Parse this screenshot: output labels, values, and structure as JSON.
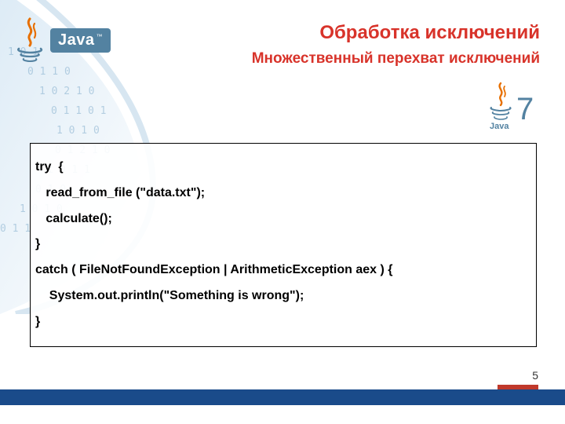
{
  "branding": {
    "wordmark": "Java",
    "trademark": "™",
    "version_badge": "7"
  },
  "headings": {
    "title": "Обработка исключений",
    "subtitle": "Множественный перехват исключений"
  },
  "code": {
    "line1": "try  {",
    "line2": "   read_from_file (\"data.txt\");",
    "line3": "   calculate();",
    "line4": "}",
    "line5": "catch ( FileNotFoundException | ArithmeticException aex ) {",
    "line6": "    System.out.println(\"Something is wrong\");",
    "line7": "}"
  },
  "footer": {
    "page_number": "5"
  }
}
